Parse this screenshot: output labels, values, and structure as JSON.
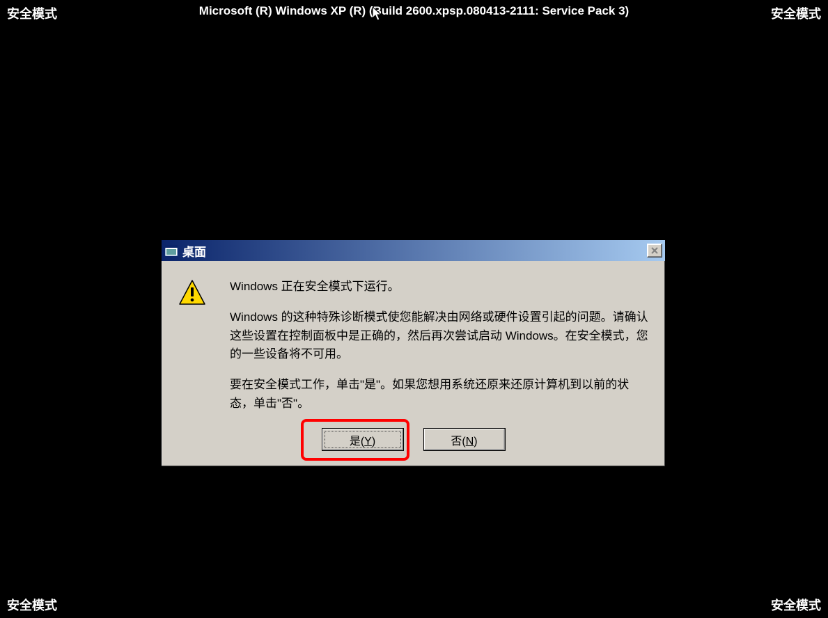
{
  "safe_mode_label": "安全模式",
  "os_header": "Microsoft (R) Windows XP (R) (Build 2600.xpsp.080413-2111: Service Pack 3)",
  "dialog": {
    "title": "桌面",
    "message1": "Windows 正在安全模式下运行。",
    "message2": "Windows 的这种特殊诊断模式使您能解决由网络或硬件设置引起的问题。请确认这些设置在控制面板中是正确的，然后再次尝试启动 Windows。在安全模式，您的一些设备将不可用。",
    "message3": "要在安全模式工作，单击\"是\"。如果您想用系统还原来还原计算机到以前的状态，单击\"否\"。",
    "yes_button": "是(Y)",
    "no_button": "否(N)"
  }
}
